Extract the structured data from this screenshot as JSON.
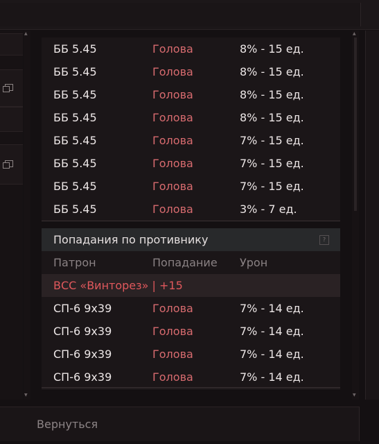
{
  "rows_top": [
    {
      "ammo": "ББ 5.45",
      "hit": "Голова",
      "damage": "8% - 15 ед."
    },
    {
      "ammo": "ББ 5.45",
      "hit": "Голова",
      "damage": "8% - 15 ед."
    },
    {
      "ammo": "ББ 5.45",
      "hit": "Голова",
      "damage": "8% - 15 ед."
    },
    {
      "ammo": "ББ 5.45",
      "hit": "Голова",
      "damage": "8% - 15 ед."
    },
    {
      "ammo": "ББ 5.45",
      "hit": "Голова",
      "damage": "7% - 15 ед."
    },
    {
      "ammo": "ББ 5.45",
      "hit": "Голова",
      "damage": "7% - 15 ед."
    },
    {
      "ammo": "ББ 5.45",
      "hit": "Голова",
      "damage": "7% - 15 ед."
    },
    {
      "ammo": "ББ 5.45",
      "hit": "Голова",
      "damage": "3% - 7 ед."
    }
  ],
  "section": {
    "title": "Попадания по противнику",
    "help": "?",
    "columns": {
      "ammo": "Патрон",
      "hit": "Попадание",
      "damage": "Урон"
    },
    "weapon": "ВСС «Винторез» | +15",
    "rows": [
      {
        "ammo": "СП-6 9x39",
        "hit": "Голова",
        "damage": "7% - 14 ед."
      },
      {
        "ammo": "СП-6 9x39",
        "hit": "Голова",
        "damage": "7% - 14 ед."
      },
      {
        "ammo": "СП-6 9x39",
        "hit": "Голова",
        "damage": "7% - 14 ед."
      },
      {
        "ammo": "СП-6 9x39",
        "hit": "Голова",
        "damage": "7% - 14 ед."
      }
    ]
  },
  "footer": {
    "back_label": "Вернуться"
  }
}
